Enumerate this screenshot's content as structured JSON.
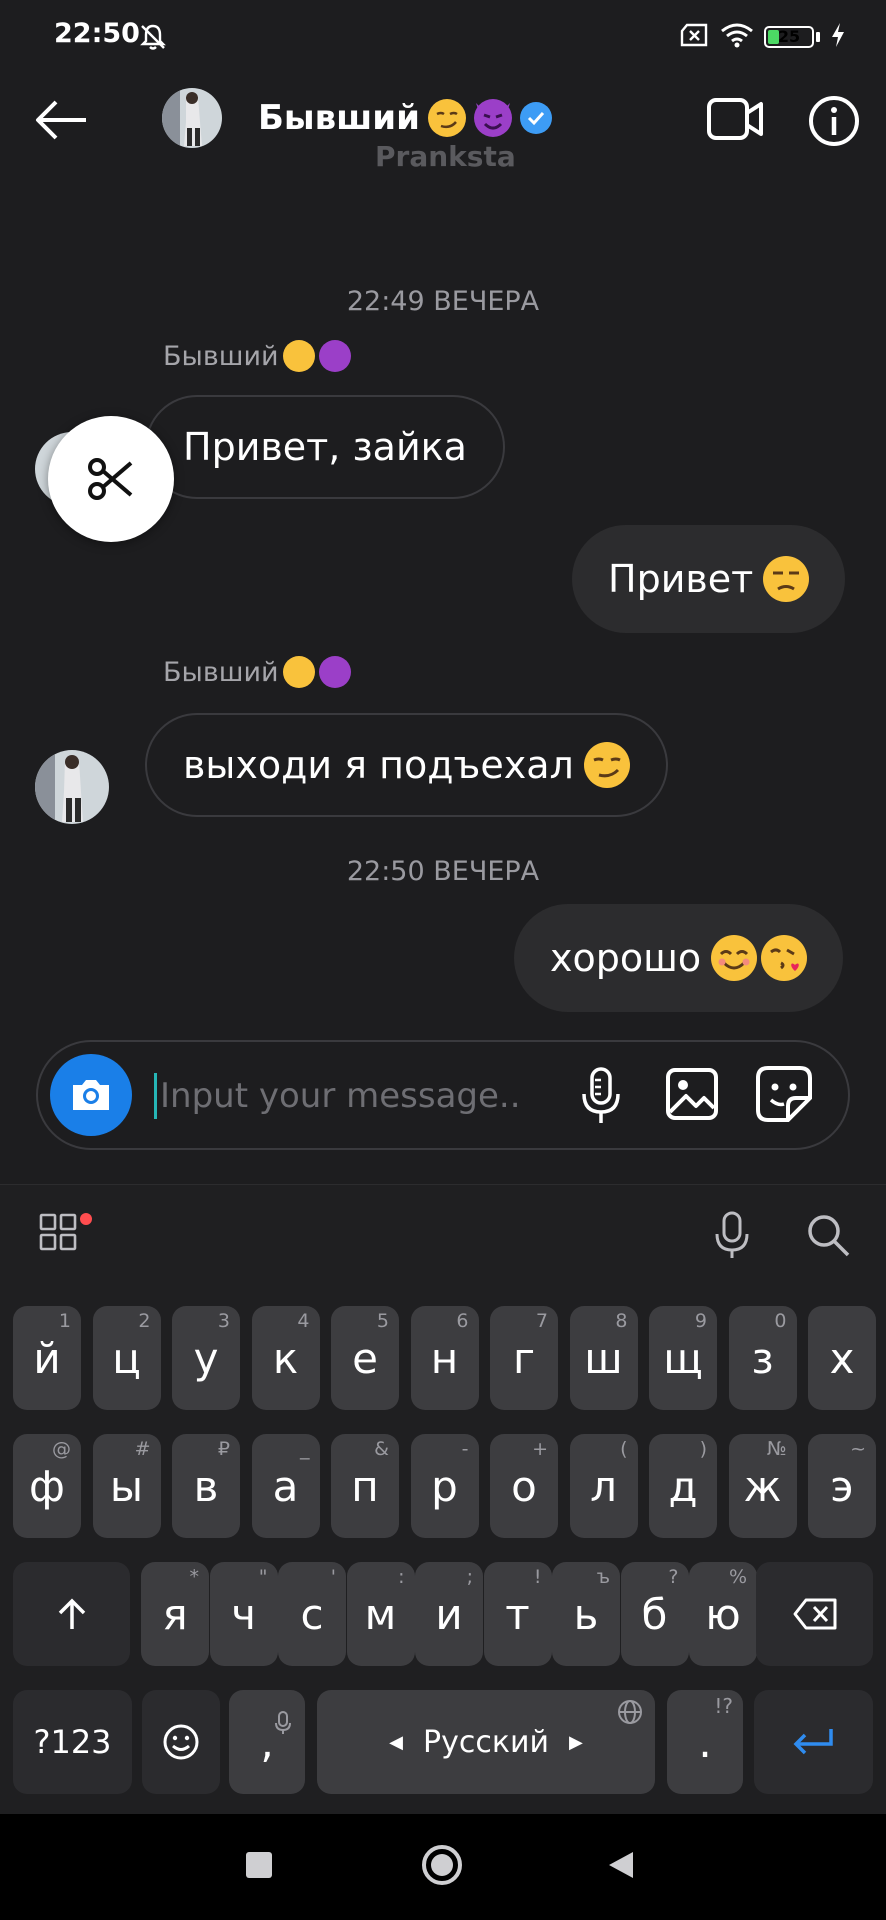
{
  "status_bar": {
    "time": "22:50",
    "battery": "25"
  },
  "header": {
    "name": "Бывший",
    "name_emojis": [
      "smirk-emoji",
      "devil-emoji"
    ],
    "watermark": "Pranksta"
  },
  "chat": {
    "timestamps": [
      "22:49 ВЕЧЕРА",
      "22:50 ВЕЧЕРА"
    ],
    "sender_label": "Бывший",
    "messages": [
      {
        "direction": "incoming",
        "text": "Привет, зайка",
        "emojis": []
      },
      {
        "direction": "outgoing",
        "text": "Привет",
        "emojis": [
          "unamused-emoji"
        ]
      },
      {
        "direction": "incoming",
        "text": "выходи я подъехал",
        "emojis": [
          "smirk-emoji"
        ]
      },
      {
        "direction": "outgoing",
        "text": "хорошо",
        "emojis": [
          "smiling-emoji",
          "kissing-heart-emoji"
        ]
      }
    ]
  },
  "input": {
    "placeholder": "Input your message..."
  },
  "keyboard": {
    "row1": [
      {
        "label": "й",
        "hint": "1"
      },
      {
        "label": "ц",
        "hint": "2"
      },
      {
        "label": "у",
        "hint": "3"
      },
      {
        "label": "к",
        "hint": "4"
      },
      {
        "label": "е",
        "hint": "5"
      },
      {
        "label": "н",
        "hint": "6"
      },
      {
        "label": "г",
        "hint": "7"
      },
      {
        "label": "ш",
        "hint": "8"
      },
      {
        "label": "щ",
        "hint": "9"
      },
      {
        "label": "з",
        "hint": "0"
      },
      {
        "label": "х",
        "hint": ""
      }
    ],
    "row2": [
      {
        "label": "ф",
        "hint": "@"
      },
      {
        "label": "ы",
        "hint": "#"
      },
      {
        "label": "в",
        "hint": "₽"
      },
      {
        "label": "а",
        "hint": "_"
      },
      {
        "label": "п",
        "hint": "&"
      },
      {
        "label": "р",
        "hint": "-"
      },
      {
        "label": "о",
        "hint": "+"
      },
      {
        "label": "л",
        "hint": "("
      },
      {
        "label": "д",
        "hint": ")"
      },
      {
        "label": "ж",
        "hint": "№"
      },
      {
        "label": "э",
        "hint": "~"
      }
    ],
    "row3": [
      {
        "label": "я",
        "hint": "*"
      },
      {
        "label": "ч",
        "hint": "\""
      },
      {
        "label": "с",
        "hint": "'"
      },
      {
        "label": "м",
        "hint": ":"
      },
      {
        "label": "и",
        "hint": ";"
      },
      {
        "label": "т",
        "hint": "!"
      },
      {
        "label": "ь",
        "hint": "ъ"
      },
      {
        "label": "б",
        "hint": "?"
      },
      {
        "label": "ю",
        "hint": "%"
      }
    ],
    "symbols_key": "?123",
    "comma_key": ",",
    "space_key": "Русский",
    "period_key": ".",
    "period_hint": "!?"
  },
  "colors": {
    "background": "#1d1d1f",
    "accent": "#1a7fe8",
    "verified": "#3d9cf5",
    "enter_key": "#2f8cf0"
  }
}
